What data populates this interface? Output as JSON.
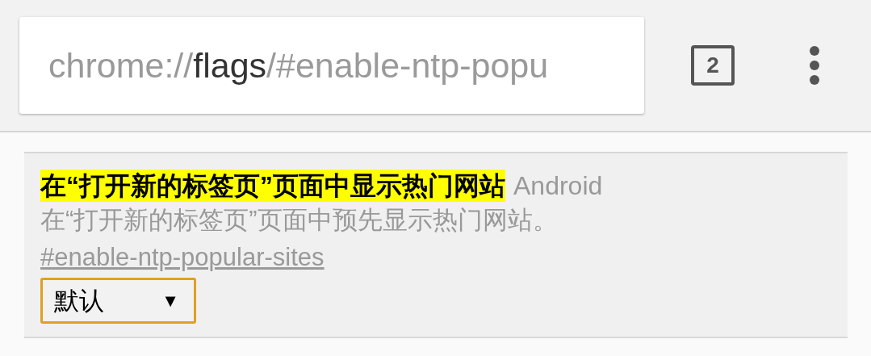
{
  "toolbar": {
    "url": {
      "scheme": "chrome://",
      "host": "flags",
      "path": "/#enable-ntp-popu"
    },
    "tab_count": "2"
  },
  "flag": {
    "title": "在“打开新的标签页”页面中显示热门网站",
    "highlighted": true,
    "platform": "Android",
    "description": "在“打开新的标签页”页面中预先显示热门网站。",
    "link": "#enable-ntp-popular-sites",
    "select": {
      "value": "默认",
      "arrow": "▼"
    }
  }
}
